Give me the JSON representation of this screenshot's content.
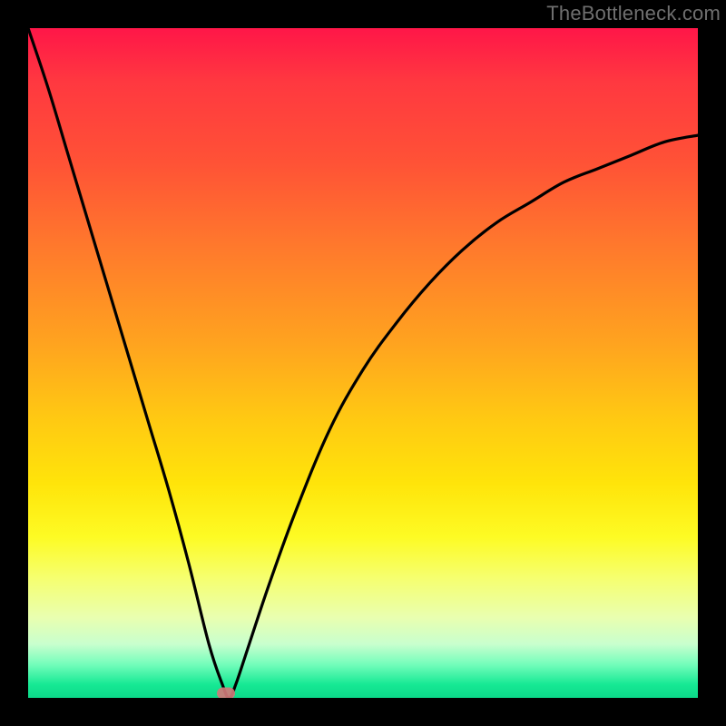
{
  "watermark": "TheBottleneck.com",
  "chart_data": {
    "type": "line",
    "title": "",
    "xlabel": "",
    "ylabel": "",
    "xlim": [
      0,
      100
    ],
    "ylim": [
      0,
      100
    ],
    "grid": false,
    "curve_note": "V-shaped curve with minimum near x≈30. Y values estimated as percentage of plot height from bottom (0) to top (100).",
    "x": [
      0,
      3,
      6,
      9,
      12,
      15,
      18,
      21,
      24,
      27,
      29,
      30,
      31,
      33,
      36,
      40,
      45,
      50,
      55,
      60,
      65,
      70,
      75,
      80,
      85,
      90,
      95,
      100
    ],
    "y": [
      100,
      91,
      81,
      71,
      61,
      51,
      41,
      31,
      20,
      8,
      2,
      0,
      2,
      8,
      17,
      28,
      40,
      49,
      56,
      62,
      67,
      71,
      74,
      77,
      79,
      81,
      83,
      84
    ],
    "marker": {
      "x": 29.5,
      "y": 0.7
    },
    "series": [
      {
        "name": "bottleneck-curve",
        "color": "#000000"
      }
    ],
    "background_gradient": {
      "top": "#ff1648",
      "mid_upper": "#ffa31f",
      "mid_lower": "#fdfb24",
      "bottom": "#0cd989"
    }
  }
}
